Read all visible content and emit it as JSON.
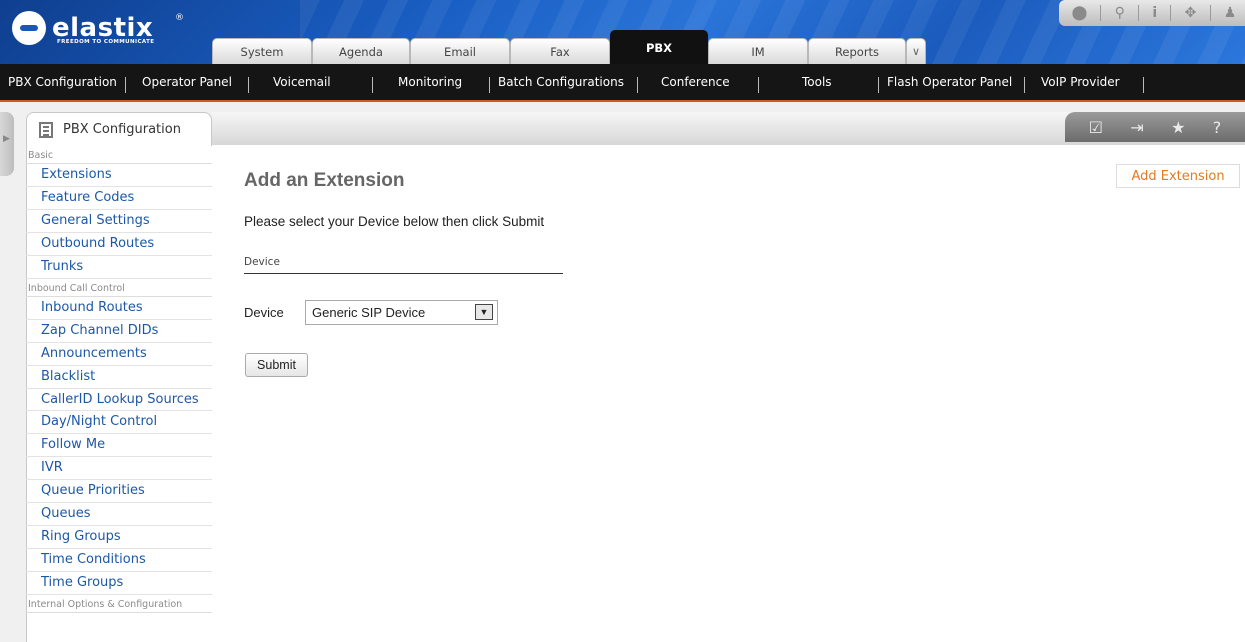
{
  "branding": {
    "logo_text": "elastix",
    "tagline": "FREEDOM TO COMMUNICATE",
    "registered_mark": "®"
  },
  "top_tools": [
    {
      "icon": "drop-icon",
      "glyph": "⬤"
    },
    {
      "icon": "search-icon",
      "glyph": "⚲"
    },
    {
      "icon": "info-icon",
      "glyph": "i"
    },
    {
      "icon": "puzzle-icon",
      "glyph": "✥"
    },
    {
      "icon": "user-icon",
      "glyph": "♟"
    }
  ],
  "main_tabs": [
    {
      "label": "System"
    },
    {
      "label": "Agenda"
    },
    {
      "label": "Email"
    },
    {
      "label": "Fax"
    },
    {
      "label": "PBX",
      "active": true
    },
    {
      "label": "IM"
    },
    {
      "label": "Reports"
    }
  ],
  "more_tab_glyph": "∨",
  "submenu": [
    {
      "label": "PBX Configuration",
      "active": true
    },
    {
      "label": "Operator Panel"
    },
    {
      "label": "Voicemail"
    },
    {
      "label": "Monitoring"
    },
    {
      "label": "Batch Configurations"
    },
    {
      "label": "Conference"
    },
    {
      "label": "Tools"
    },
    {
      "label": "Flash Operator Panel"
    },
    {
      "label": "VoIP Provider"
    }
  ],
  "page": {
    "title": "PBX Configuration",
    "tool_icons": [
      {
        "icon": "edit-icon",
        "glyph": "☑"
      },
      {
        "icon": "export-icon",
        "glyph": "⇥"
      },
      {
        "icon": "star-icon",
        "glyph": "★"
      },
      {
        "icon": "help-icon",
        "glyph": "?"
      }
    ]
  },
  "nav": {
    "sections": [
      {
        "label": "Basic",
        "items": [
          "Extensions",
          "Feature Codes",
          "General Settings",
          "Outbound Routes",
          "Trunks"
        ]
      },
      {
        "label": "Inbound Call Control",
        "items": [
          "Inbound Routes",
          "Zap Channel DIDs",
          "Announcements",
          "Blacklist",
          "CallerID Lookup Sources",
          "Day/Night Control",
          "Follow Me",
          "IVR",
          "Queue Priorities",
          "Queues",
          "Ring Groups",
          "Time Conditions",
          "Time Groups"
        ]
      },
      {
        "label": "Internal Options & Configuration",
        "items": []
      }
    ]
  },
  "form": {
    "heading": "Add an Extension",
    "intro": "Please select your Device below then click Submit",
    "section_label": "Device",
    "device_label": "Device",
    "device_value": "Generic SIP Device",
    "submit_label": "Submit"
  },
  "add_extension_link": "Add Extension",
  "colors": {
    "header_blue": "#1a5fc4",
    "submenu_bg": "#151515",
    "nav_link": "#1d58a7",
    "accent_orange": "#e47a1d"
  }
}
